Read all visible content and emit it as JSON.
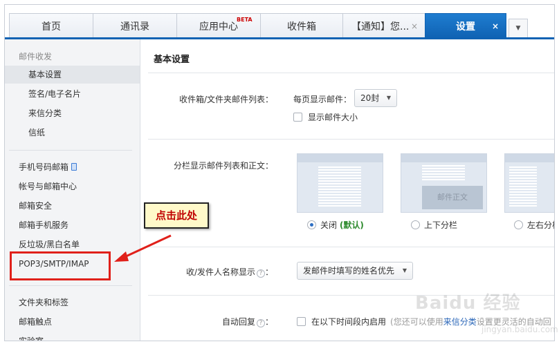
{
  "tabs": [
    {
      "label": "首页"
    },
    {
      "label": "通讯录"
    },
    {
      "label": "应用中心",
      "badge": "BETA"
    },
    {
      "label": "收件箱"
    },
    {
      "label": "【通知】您...",
      "close": "×"
    },
    {
      "label": "设置",
      "close": "×",
      "active": true
    }
  ],
  "tab_more": "▼",
  "sidebar": {
    "group1": "邮件收发",
    "items1": [
      "基本设置",
      "签名/电子名片",
      "来信分类",
      "信纸"
    ],
    "items2": [
      "手机号码邮箱",
      "帐号与邮箱中心",
      "邮箱安全",
      "邮箱手机服务",
      "反垃圾/黑白名单",
      "POP3/SMTP/IMAP"
    ],
    "items3": [
      "文件夹和标签",
      "邮箱触点",
      "实验室"
    ]
  },
  "main": {
    "title": "基本设置",
    "inbox_label": "收件箱/文件夹邮件列表：",
    "per_page_label": "每页显示邮件：",
    "per_page_value": "20封",
    "show_size": "显示邮件大小",
    "split_label": "分栏显示邮件列表和正文：",
    "preview_text": "邮件正文",
    "layout_options": [
      {
        "label": "关闭",
        "extra": "(默认)",
        "selected": true
      },
      {
        "label": "上下分栏",
        "selected": false
      },
      {
        "label": "左右分栏",
        "selected": false
      }
    ],
    "sender_label": "收/发件人名称显示",
    "sender_value": "发邮件时填写的姓名优先",
    "autoreply_label": "自动回复",
    "autoreply_option": "在以下时间段内启用",
    "autoreply_hint": "(您还可以使用",
    "autoreply_link": "来信分类",
    "autoreply_tail": "设置更灵活的自动回"
  },
  "annotation": {
    "callout_text": "点击此处",
    "arrow_color": "#e0201a"
  },
  "watermark": {
    "brand": "Baidu 经验",
    "url": "jingyan.baidu.com"
  },
  "colors": {
    "accent": "#0f62b3",
    "highlight": "#e0201a",
    "callout_bg": "#fff9c9"
  }
}
